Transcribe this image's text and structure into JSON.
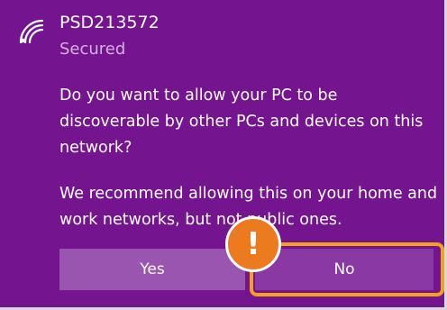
{
  "network": {
    "name": "PSD213572",
    "status": "Secured",
    "icon": "wifi-icon"
  },
  "message": {
    "question": "Do you want to allow your PC to be discoverable by other PCs and devices on this network?",
    "recommendation": "We recommend allowing this on your home and work networks, but not public ones."
  },
  "buttons": {
    "yes_label": "Yes",
    "no_label": "No"
  },
  "callout": {
    "symbol": "!",
    "icon": "warning-icon"
  },
  "colors": {
    "background": "#74148f",
    "yes_button": "#9a55b0",
    "no_button": "#8a39a4",
    "highlight": "#f3a31a",
    "badge": "#ec7a1f"
  }
}
